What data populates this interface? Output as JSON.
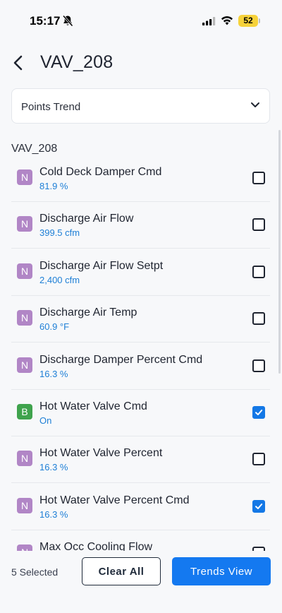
{
  "status_bar": {
    "time": "15:17",
    "battery": "52",
    "icons": [
      "bell-off-icon",
      "signal-icon",
      "wifi-icon",
      "battery-icon"
    ]
  },
  "header": {
    "title": "VAV_208",
    "back_icon": "chevron-left-icon"
  },
  "dropdown": {
    "selected": "Points Trend",
    "icon": "chevron-down-icon"
  },
  "section": {
    "title": "VAV_208"
  },
  "points": [
    {
      "badge": "N",
      "name": "Cold Deck Damper Cmd",
      "value": "81.9 %",
      "checked": false
    },
    {
      "badge": "N",
      "name": "Discharge Air Flow",
      "value": "399.5 cfm",
      "checked": false
    },
    {
      "badge": "N",
      "name": "Discharge Air Flow Setpt",
      "value": "2,400 cfm",
      "checked": false
    },
    {
      "badge": "N",
      "name": "Discharge Air Temp",
      "value": "60.9 °F",
      "checked": false
    },
    {
      "badge": "N",
      "name": "Discharge Damper Percent Cmd",
      "value": "16.3 %",
      "checked": false
    },
    {
      "badge": "B",
      "name": "Hot Water Valve Cmd",
      "value": "On",
      "checked": true
    },
    {
      "badge": "N",
      "name": "Hot Water Valve Percent",
      "value": "16.3 %",
      "checked": false
    },
    {
      "badge": "N",
      "name": "Hot Water Valve Percent Cmd",
      "value": "16.3 %",
      "checked": true
    },
    {
      "badge": "N",
      "name": "Max Occ Cooling Flow",
      "value": "",
      "checked": false
    }
  ],
  "footer": {
    "selected_count": "5 Selected",
    "clear_label": "Clear All",
    "trends_label": "Trends View"
  },
  "colors": {
    "accent": "#1479f0",
    "value_text": "#1e7fd6",
    "badge_numeric": "#b186c6",
    "badge_binary": "#3fa34d",
    "battery": "#f6d23a"
  }
}
